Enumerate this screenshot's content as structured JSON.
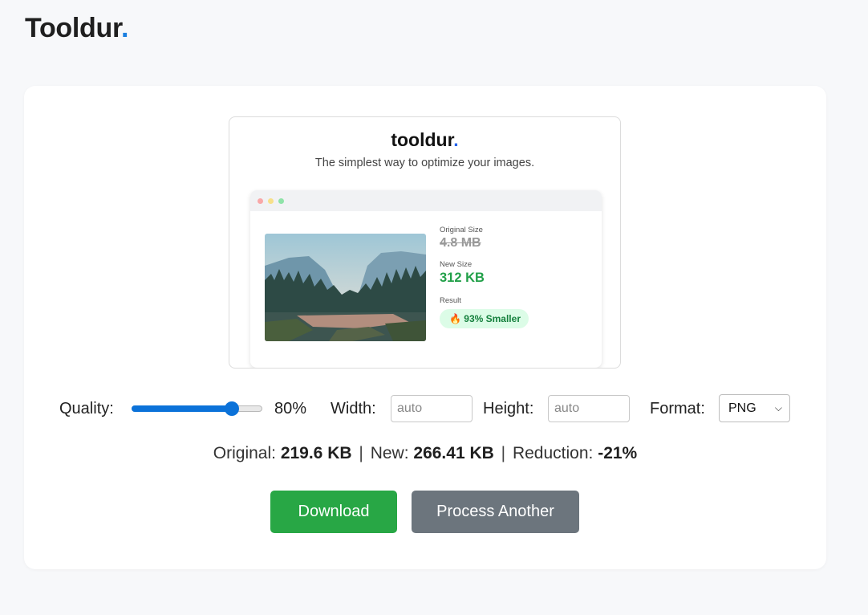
{
  "brand": {
    "name": "Tooldur",
    "dot": "."
  },
  "preview": {
    "logo": "tooldur",
    "logo_dot": ".",
    "tagline": "The simplest way to optimize your images.",
    "original_label": "Original Size",
    "original_value": "4.8 MB",
    "new_label": "New Size",
    "new_value": "312 KB",
    "result_label": "Result",
    "result_badge": "🔥 93% Smaller"
  },
  "controls": {
    "quality_label": "Quality:",
    "quality_value": 80,
    "quality_display": "80%",
    "width_label": "Width:",
    "width_placeholder": "auto",
    "height_label": "Height:",
    "height_placeholder": "auto",
    "format_label": "Format:",
    "format_selected": "PNG"
  },
  "summary": {
    "original_label": "Original:",
    "original_value": "219.6 KB",
    "new_label": "New:",
    "new_value": "266.41 KB",
    "reduction_label": "Reduction:",
    "reduction_value": "-21%"
  },
  "buttons": {
    "download": "Download",
    "process_another": "Process Another"
  },
  "colors": {
    "accent": "#0b72d9",
    "download": "#28a745",
    "secondary": "#6c757d"
  }
}
